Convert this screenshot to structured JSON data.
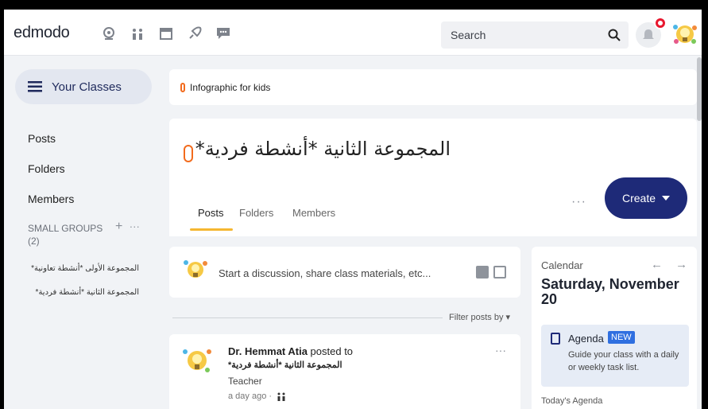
{
  "topbar": {
    "logo": "edmodo",
    "search_placeholder": "Search",
    "icons": [
      "discover-icon",
      "groups-icon",
      "planner-icon",
      "spotlight-icon",
      "messages-icon",
      "search-icon",
      "notifications-icon"
    ],
    "notification_badge_color": "#e8182f"
  },
  "sidebar": {
    "your_classes": "Your Classes",
    "links": [
      "Posts",
      "Folders",
      "Members"
    ],
    "small_groups_label": "SMALL GROUPS",
    "small_groups_count": "(2)",
    "small_groups_add": "+",
    "small_groups_more": "···",
    "groups": [
      "المجموعة الأولى *أنشطة تعاونية*",
      "المجموعة الثانية *أنشطة فردية*"
    ]
  },
  "notice": {
    "text": "Infographic for kids"
  },
  "header": {
    "title": "المجموعة الثانية *أنشطة فردية*",
    "tabs": [
      "Posts",
      "Folders",
      "Members"
    ],
    "more": "···",
    "create_label": "Create"
  },
  "compose": {
    "placeholder": "Start a discussion, share class materials, etc..."
  },
  "filter": {
    "label": "Filter posts by ▾"
  },
  "post": {
    "author": "Dr. Hemmat Atia",
    "posted_to": " posted to",
    "group": "المجموعة الثانية *أنشطة فردية*",
    "role": "Teacher",
    "time": "a day ago ·",
    "more": "···"
  },
  "calendar": {
    "label": "Calendar",
    "arrows": "← →",
    "date": "Saturday, November 20",
    "agenda_title": "Agenda",
    "agenda_badge": "NEW",
    "agenda_desc": "Guide your class with a daily or weekly task list.",
    "today": "Today's Agenda"
  },
  "colors": {
    "accent": "#1e2a78",
    "orange": "#f26b1d",
    "tab_underline": "#f5b731",
    "new_badge": "#2f6fe0"
  }
}
